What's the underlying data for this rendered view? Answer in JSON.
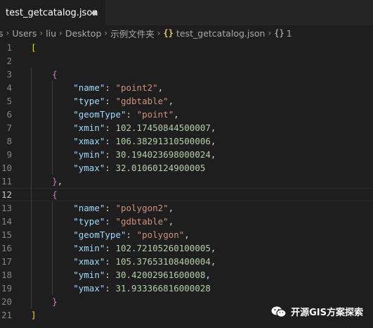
{
  "tab": {
    "title": "test_getcatalog.json"
  },
  "breadcrumb": {
    "parts": [
      "s",
      "Users",
      "liu",
      "Desktop",
      "示例文件夹",
      "test_getcatalog.json",
      "1"
    ],
    "json_icon": "{}",
    "obj_icon": "{}"
  },
  "editor": {
    "lines": [
      {
        "n": "1",
        "indent": 0,
        "tokens": [
          {
            "t": "[",
            "c": "b1"
          }
        ]
      },
      {
        "n": "2",
        "indent": 0,
        "tokens": []
      },
      {
        "n": "3",
        "indent": 4,
        "tokens": [
          {
            "t": "{",
            "c": "b2"
          }
        ]
      },
      {
        "n": "4",
        "indent": 8,
        "tokens": [
          {
            "t": "\"name\"",
            "c": "k"
          },
          {
            "t": ": ",
            "c": "p"
          },
          {
            "t": "\"point2\"",
            "c": "s"
          },
          {
            "t": ",",
            "c": "p"
          }
        ]
      },
      {
        "n": "5",
        "indent": 8,
        "tokens": [
          {
            "t": "\"type\"",
            "c": "k"
          },
          {
            "t": ": ",
            "c": "p"
          },
          {
            "t": "\"gdbtable\"",
            "c": "s"
          },
          {
            "t": ",",
            "c": "p"
          }
        ]
      },
      {
        "n": "6",
        "indent": 8,
        "tokens": [
          {
            "t": "\"geomType\"",
            "c": "k"
          },
          {
            "t": ": ",
            "c": "p"
          },
          {
            "t": "\"point\"",
            "c": "s"
          },
          {
            "t": ",",
            "c": "p"
          }
        ]
      },
      {
        "n": "7",
        "indent": 8,
        "tokens": [
          {
            "t": "\"xmin\"",
            "c": "k"
          },
          {
            "t": ": ",
            "c": "p"
          },
          {
            "t": "102.17450844500007",
            "c": "n"
          },
          {
            "t": ",",
            "c": "p"
          }
        ]
      },
      {
        "n": "8",
        "indent": 8,
        "tokens": [
          {
            "t": "\"xmax\"",
            "c": "k"
          },
          {
            "t": ": ",
            "c": "p"
          },
          {
            "t": "106.38291310500006",
            "c": "n"
          },
          {
            "t": ",",
            "c": "p"
          }
        ]
      },
      {
        "n": "9",
        "indent": 8,
        "tokens": [
          {
            "t": "\"ymin\"",
            "c": "k"
          },
          {
            "t": ": ",
            "c": "p"
          },
          {
            "t": "30.194023698000024",
            "c": "n"
          },
          {
            "t": ",",
            "c": "p"
          }
        ]
      },
      {
        "n": "10",
        "indent": 8,
        "tokens": [
          {
            "t": "\"ymax\"",
            "c": "k"
          },
          {
            "t": ": ",
            "c": "p"
          },
          {
            "t": "32.01060124900005",
            "c": "n"
          }
        ]
      },
      {
        "n": "11",
        "indent": 4,
        "tokens": [
          {
            "t": "}",
            "c": "b2"
          },
          {
            "t": ",",
            "c": "p"
          }
        ]
      },
      {
        "n": "12",
        "indent": 4,
        "tokens": [
          {
            "t": "{",
            "c": "b2"
          }
        ],
        "current": true
      },
      {
        "n": "13",
        "indent": 8,
        "tokens": [
          {
            "t": "\"name\"",
            "c": "k"
          },
          {
            "t": ": ",
            "c": "p"
          },
          {
            "t": "\"polygon2\"",
            "c": "s"
          },
          {
            "t": ",",
            "c": "p"
          }
        ]
      },
      {
        "n": "14",
        "indent": 8,
        "tokens": [
          {
            "t": "\"type\"",
            "c": "k"
          },
          {
            "t": ": ",
            "c": "p"
          },
          {
            "t": "\"gdbtable\"",
            "c": "s"
          },
          {
            "t": ",",
            "c": "p"
          }
        ]
      },
      {
        "n": "15",
        "indent": 8,
        "tokens": [
          {
            "t": "\"geomType\"",
            "c": "k"
          },
          {
            "t": ": ",
            "c": "p"
          },
          {
            "t": "\"polygon\"",
            "c": "s"
          },
          {
            "t": ",",
            "c": "p"
          }
        ]
      },
      {
        "n": "16",
        "indent": 8,
        "tokens": [
          {
            "t": "\"xmin\"",
            "c": "k"
          },
          {
            "t": ": ",
            "c": "p"
          },
          {
            "t": "102.72105260100005",
            "c": "n"
          },
          {
            "t": ",",
            "c": "p"
          }
        ]
      },
      {
        "n": "17",
        "indent": 8,
        "tokens": [
          {
            "t": "\"xmax\"",
            "c": "k"
          },
          {
            "t": ": ",
            "c": "p"
          },
          {
            "t": "105.37653108400004",
            "c": "n"
          },
          {
            "t": ",",
            "c": "p"
          }
        ]
      },
      {
        "n": "18",
        "indent": 8,
        "tokens": [
          {
            "t": "\"ymin\"",
            "c": "k"
          },
          {
            "t": ": ",
            "c": "p"
          },
          {
            "t": "30.42002961600008",
            "c": "n"
          },
          {
            "t": ",",
            "c": "p"
          }
        ]
      },
      {
        "n": "19",
        "indent": 8,
        "tokens": [
          {
            "t": "\"ymax\"",
            "c": "k"
          },
          {
            "t": ": ",
            "c": "p"
          },
          {
            "t": "31.933366816000028",
            "c": "n"
          }
        ]
      },
      {
        "n": "20",
        "indent": 4,
        "tokens": [
          {
            "t": "}",
            "c": "b2"
          }
        ]
      },
      {
        "n": "21",
        "indent": 0,
        "tokens": [
          {
            "t": "]",
            "c": "b1"
          }
        ]
      }
    ]
  },
  "watermark": {
    "text": "开源GIS方案探索",
    "icon": "wechat-icon"
  },
  "colors": {
    "background": "#1e1e1e",
    "tabbar": "#252526",
    "key": "#9cdcfe",
    "string": "#ce9178",
    "number": "#b5cea8",
    "bracket_outer": "#ffd700",
    "bracket_inner": "#da70d6"
  }
}
